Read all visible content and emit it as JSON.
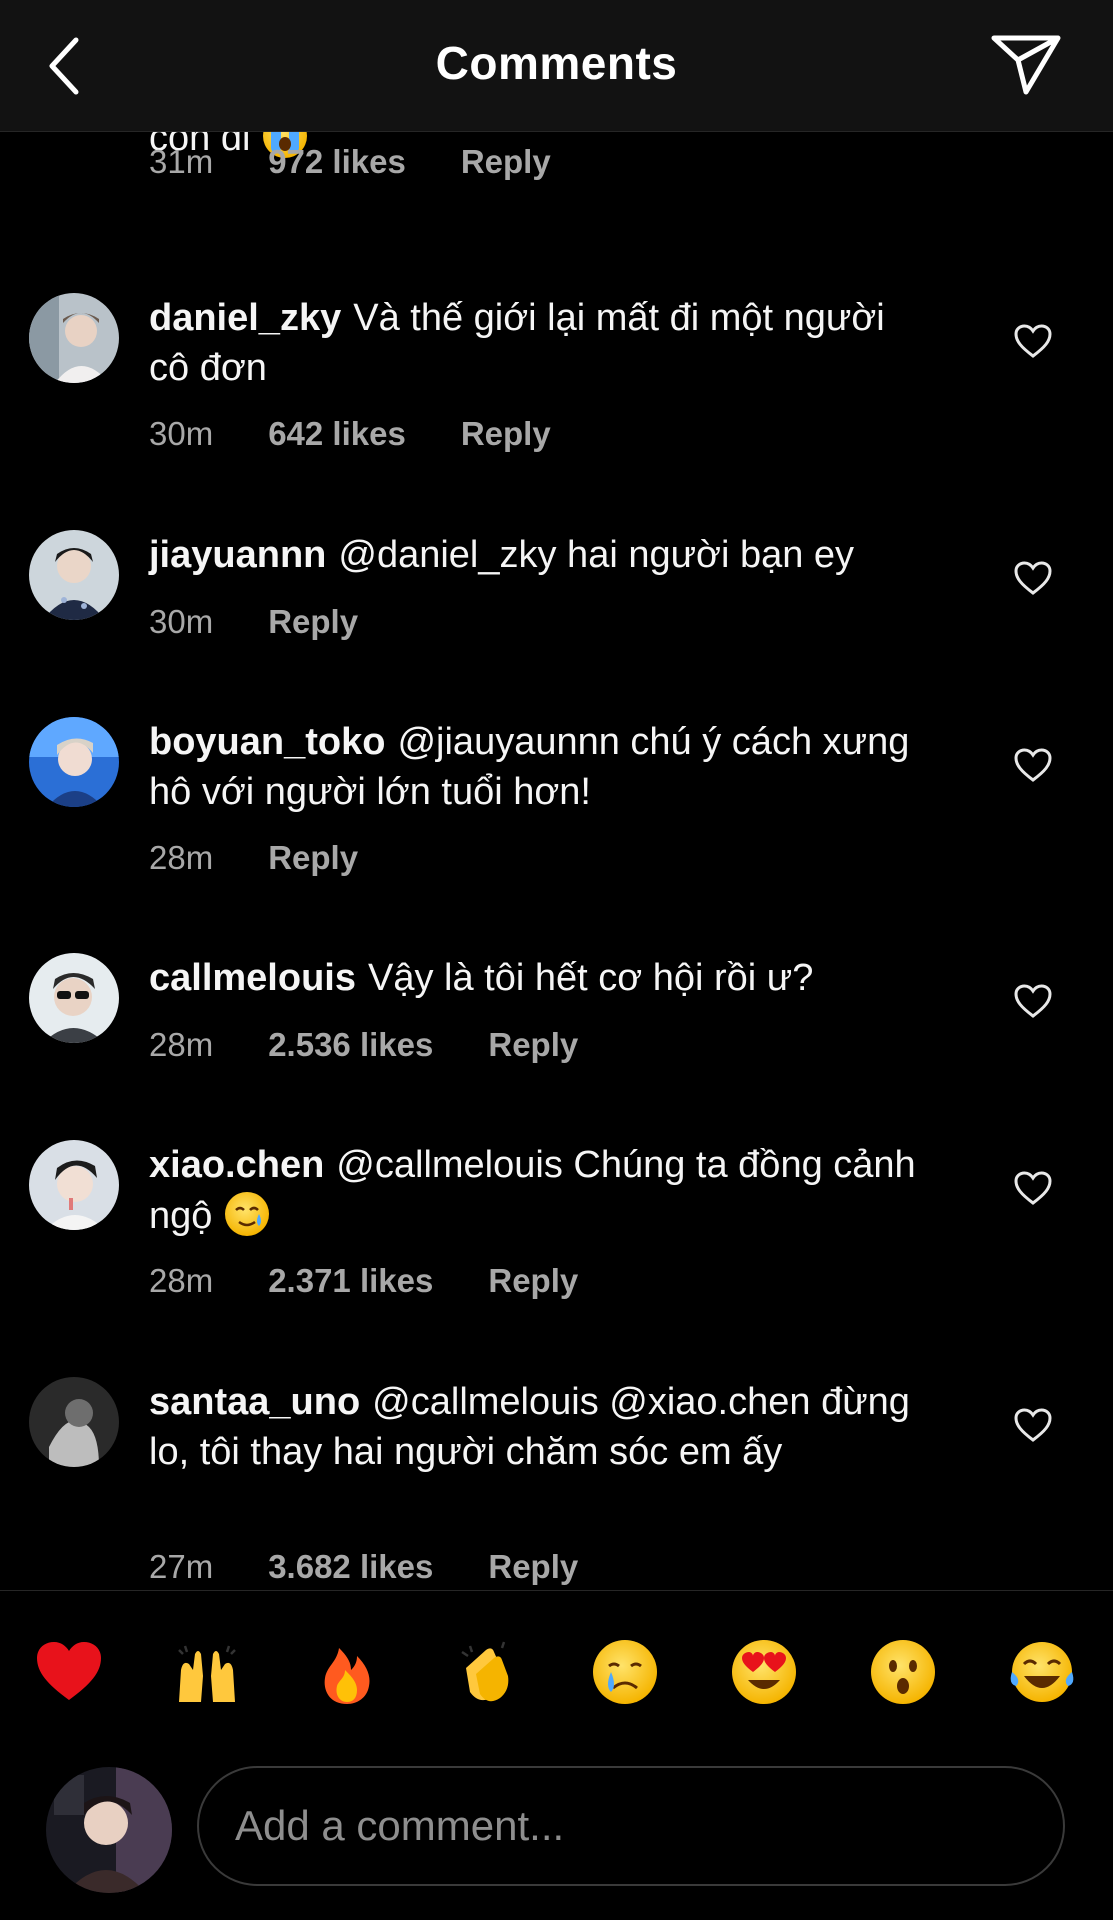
{
  "header": {
    "title": "Comments",
    "back_icon": "chevron-left-icon",
    "share_icon": "paper-plane-icon"
  },
  "partial_comment": {
    "text_fragment": "con đi",
    "emoji": "loudly-crying-face",
    "time": "31m",
    "likes": "972 likes",
    "reply": "Reply"
  },
  "comments": [
    {
      "username": "daniel_zky",
      "text": "Và thế giới lại mất đi một người cô đơn",
      "time": "30m",
      "likes": "642 likes",
      "reply": "Reply"
    },
    {
      "username": "jiayuannn",
      "text": "@daniel_zky hai người bạn ey",
      "time": "30m",
      "likes": "",
      "reply": "Reply"
    },
    {
      "username": "boyuan_toko",
      "text": "@jiauyaunnn chú ý cách xưng hô với người lớn tuổi hơn!",
      "time": "28m",
      "likes": "",
      "reply": "Reply"
    },
    {
      "username": "callmelouis",
      "text": "Vậy là tôi hết cơ hội rồi ư?",
      "time": "28m",
      "likes": "2.536 likes",
      "reply": "Reply"
    },
    {
      "username": "xiao.chen",
      "text": "@callmelouis Chúng ta đồng cảnh ngộ",
      "emoji": "smiling-face-with-tear",
      "time": "28m",
      "likes": "2.371 likes",
      "reply": "Reply"
    },
    {
      "username": "santaa_uno",
      "text": "@callmelouis @xiao.chen đừng lo, tôi thay hai người chăm sóc em ấy",
      "time": "27m",
      "likes": "3.682 likes",
      "reply": "Reply"
    }
  ],
  "reactions": [
    "red-heart",
    "raising-hands",
    "fire",
    "clapping-hands",
    "crying-face",
    "heart-eyes",
    "hushed-face",
    "tears-of-joy"
  ],
  "composer": {
    "placeholder": "Add a comment..."
  },
  "colors": {
    "background": "#000000",
    "header_bg": "#121212",
    "text": "#f5f5f5",
    "meta": "#a8a8a8",
    "divider": "#262626"
  }
}
